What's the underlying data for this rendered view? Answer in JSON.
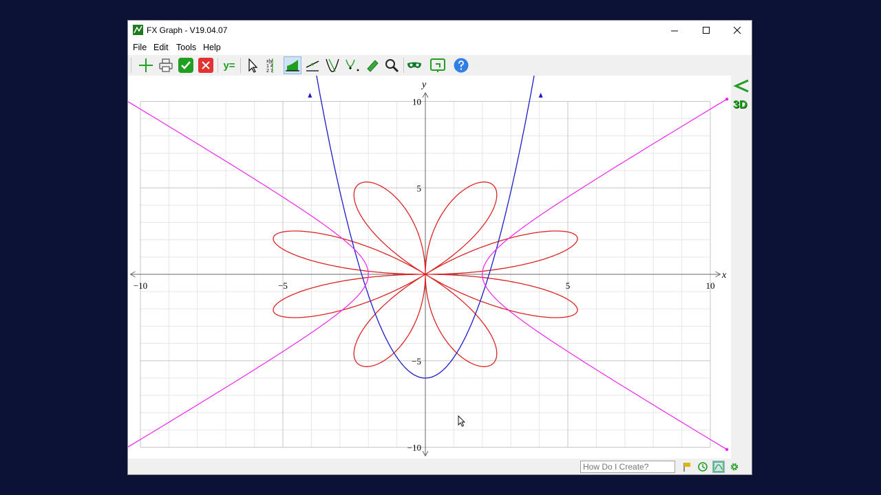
{
  "window": {
    "title": "FX Graph - V19.04.07"
  },
  "menu": {
    "items": [
      "File",
      "Edit",
      "Tools",
      "Help"
    ]
  },
  "toolbar": {
    "y_equals_label": "y=",
    "table_icon_text": "x|y 1 4 2 7",
    "active_tool": "area-tool"
  },
  "right_panel": {
    "threed_label": "3D"
  },
  "status": {
    "search_placeholder": "How Do I Create?"
  },
  "colors": {
    "polar_rose": "#dd2222",
    "parabola": "#1a1acc",
    "hyperbola": "#ee22ee",
    "accent_green": "#1f9e1f"
  },
  "chart_data": {
    "type": "line",
    "xlabel": "x",
    "ylabel": "y",
    "xlim": [
      -10,
      10
    ],
    "ylim": [
      -10,
      10
    ],
    "x_ticks": [
      -10,
      -5,
      5,
      10
    ],
    "y_ticks": [
      10,
      5,
      -5,
      -10
    ],
    "x_tick_labels": [
      "−10",
      "−5",
      "5",
      "10"
    ],
    "y_tick_labels": [
      "10",
      "5",
      "−5",
      "−10"
    ],
    "grid": true,
    "series": [
      {
        "kind": "polar-rose",
        "color": "#dd2222",
        "points": [
          [
            -5.6,
            1.3
          ],
          [
            -2.7,
            3.3
          ],
          [
            0,
            0
          ],
          [
            2.7,
            3.3
          ],
          [
            5.6,
            1.3
          ],
          [
            5.6,
            -1.3
          ],
          [
            2.7,
            -3.3
          ],
          [
            0,
            0
          ],
          [
            -2.7,
            -3.3
          ],
          [
            -5.6,
            -1.3
          ]
        ]
      },
      {
        "kind": "parabola",
        "color": "#1a1acc",
        "points": [
          [
            -4.05,
            10.5
          ],
          [
            -2,
            -1.2
          ],
          [
            0,
            -6
          ],
          [
            2,
            -1.2
          ],
          [
            4.05,
            10.5
          ]
        ]
      },
      {
        "kind": "hyperbola",
        "color": "#ee22ee",
        "points": [
          [
            -10.6,
            10.2
          ],
          [
            -2,
            0
          ],
          [
            -10.6,
            -10.2
          ],
          [
            10.6,
            10.2
          ],
          [
            2,
            0
          ],
          [
            10.6,
            -10.2
          ]
        ]
      }
    ]
  }
}
